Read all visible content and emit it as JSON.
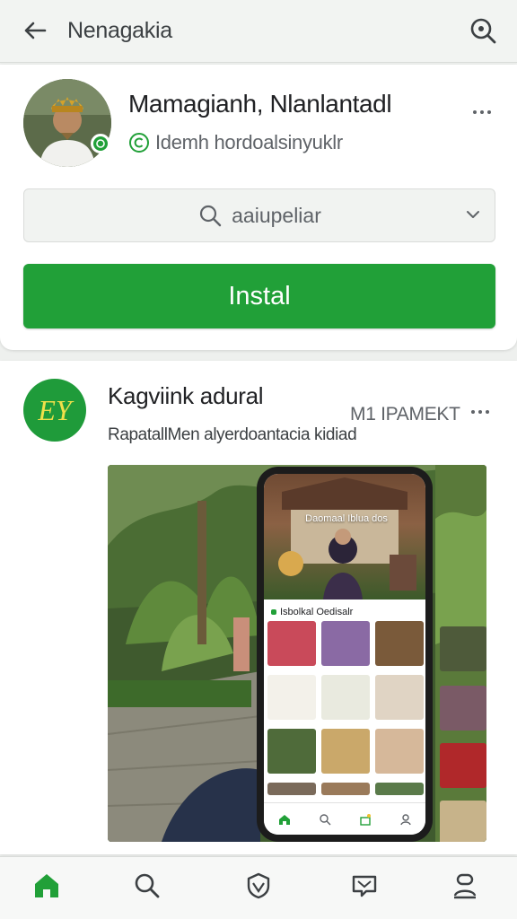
{
  "appbar": {
    "title": "Nenagakia",
    "back_icon": "arrow-left-icon",
    "search_icon": "search-icon"
  },
  "developer": {
    "name": "Mamagianh, Nlanlantadl",
    "subtitle": "Idemh hordoalsinyuklr",
    "subtitle_icon": "copyright-circle-icon",
    "avatar_badge_icon": "verified-badge-icon"
  },
  "dropdown": {
    "label": "aaiupeliar",
    "icon": "search-icon",
    "chevron": "chevron-down-icon"
  },
  "install": {
    "label": "Instal",
    "color": "#21a038"
  },
  "app_card": {
    "logo_text": "EY",
    "name": "Kagviink adural",
    "tag": "M1 IPAMEKT",
    "description": "RapatallMen alyerdoantacia kidiad",
    "logo_color": "#1f9b3a"
  },
  "screenshot": {
    "hero_title": "Daomaal Iblua dos",
    "section_title": "Isbolkal Oedisalr"
  },
  "bottom_nav": {
    "items": [
      "home-icon",
      "search-icon",
      "shield-icon",
      "chat-icon",
      "profile-icon"
    ],
    "active": "home-icon",
    "active_color": "#21a038"
  }
}
